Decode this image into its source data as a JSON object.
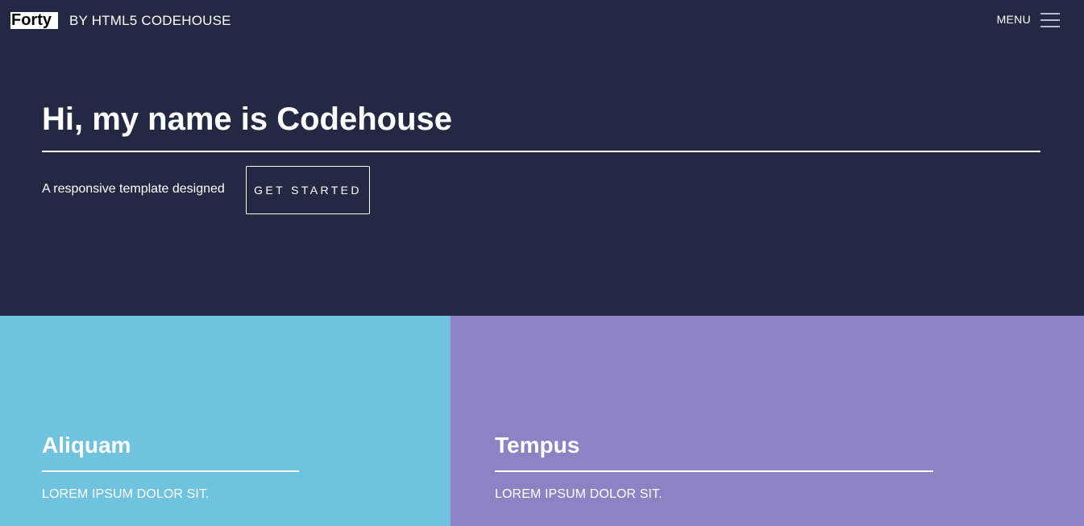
{
  "header": {
    "logo": "Forty",
    "byline": "BY HTML5 CODEHOUSE",
    "menu_label": "MENU",
    "menu_icon": "hamburger-icon"
  },
  "hero": {
    "title": "Hi, my name is Codehouse",
    "subtitle": "A responsive template designed",
    "button_label": "GET STARTED"
  },
  "tiles": [
    {
      "title": "Aliquam",
      "text": "LOREM IPSUM DOLOR SIT.",
      "color": "#6fc3df"
    },
    {
      "title": "Tempus",
      "text": "LOREM IPSUM DOLOR SIT.",
      "color": "#8d82c4"
    }
  ],
  "colors": {
    "background": "#242943",
    "accent_white": "#ffffff"
  }
}
